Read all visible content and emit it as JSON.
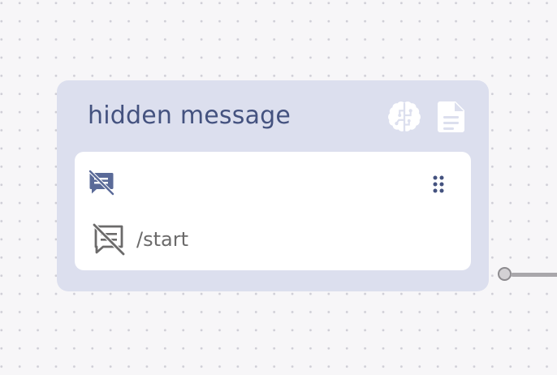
{
  "node": {
    "title": "hidden message",
    "icons": {
      "header_left": "brain-icon",
      "header_right": "document-icon",
      "card_top": "hidden-message-icon",
      "card_handle": "drag-handle-icon",
      "command": "hidden-message-icon"
    },
    "card": {
      "command_text": "/start"
    }
  },
  "colors": {
    "canvas": "#f7f6f8",
    "canvas_dot": "#cfced6",
    "node_bg": "#dcdfee",
    "title": "#44527f",
    "icon_blue": "#5a6a98",
    "command_gray": "#6b6a6a",
    "connector": "#a9a7ab"
  }
}
